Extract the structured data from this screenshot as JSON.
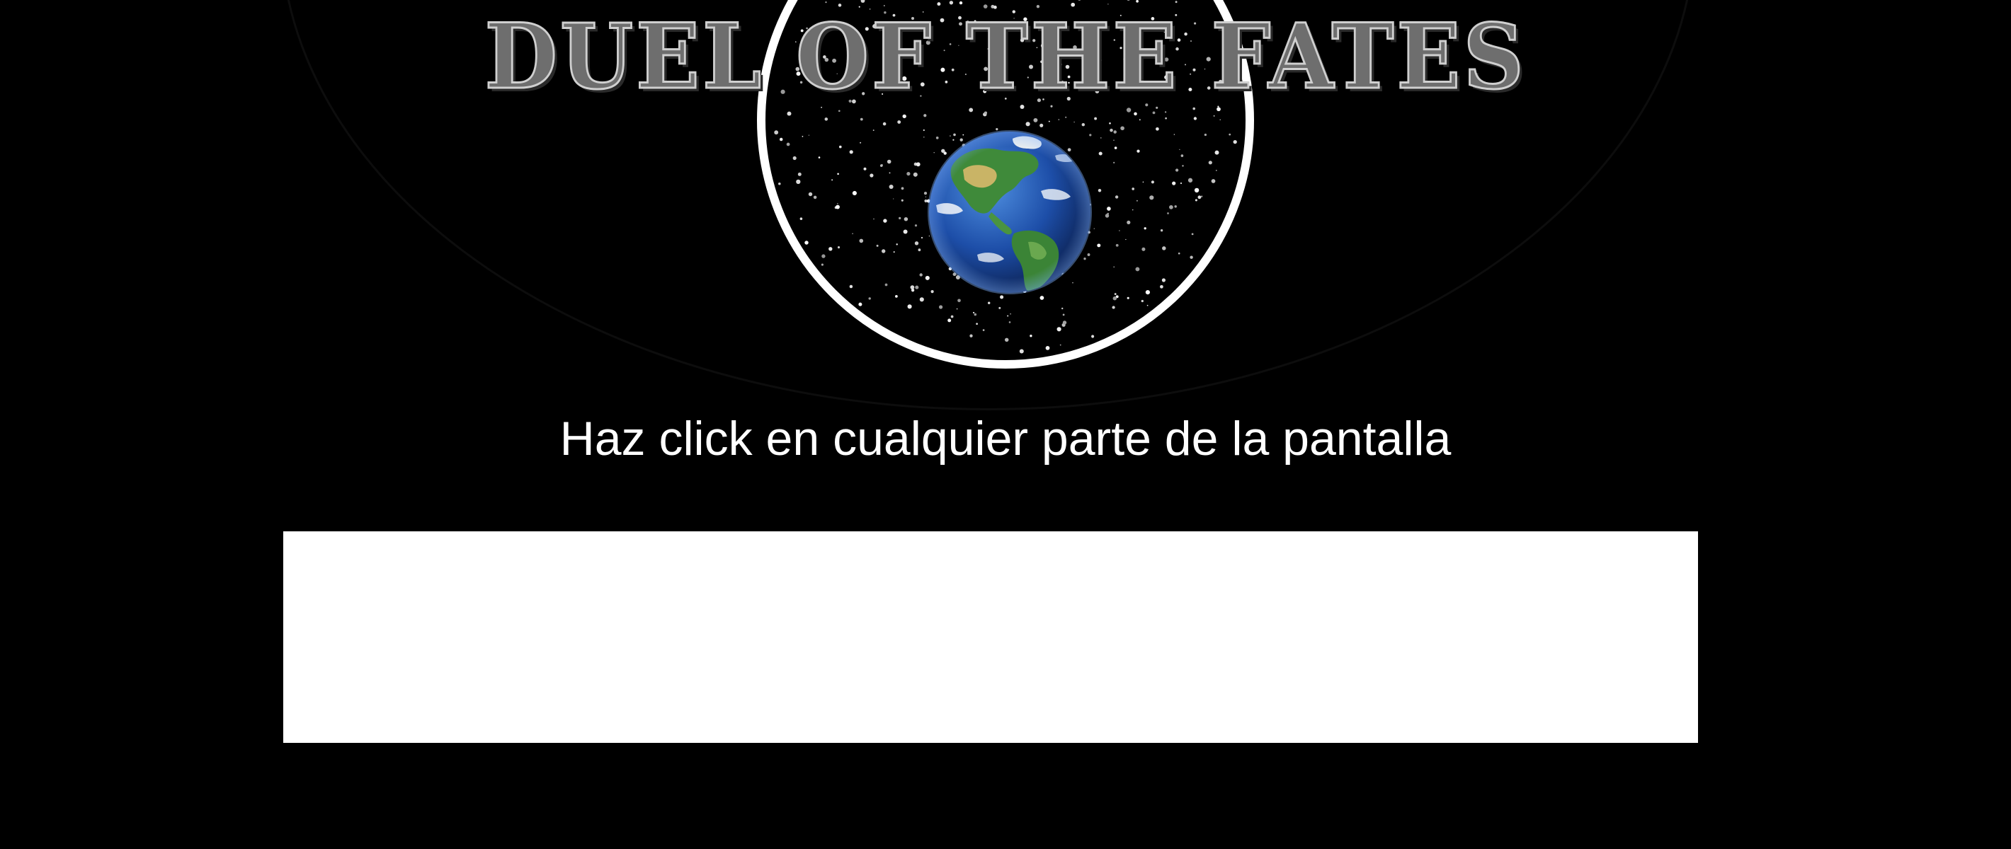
{
  "game": {
    "title": "DUEL OF THE FATES",
    "prompt": "Haz click en cualquier parte de la pantalla"
  },
  "colors": {
    "background": "#000000",
    "title_fill": "#6e6e6e",
    "title_outline": "#cfcfcf",
    "prompt_text": "#ffffff",
    "ring": "#ffffff",
    "panel": "#ffffff",
    "ocean": "#1f4fa8",
    "land": "#3f8a3a"
  },
  "icons": {
    "globe": "earth-globe-icon",
    "ring": "portal-ring-icon"
  }
}
